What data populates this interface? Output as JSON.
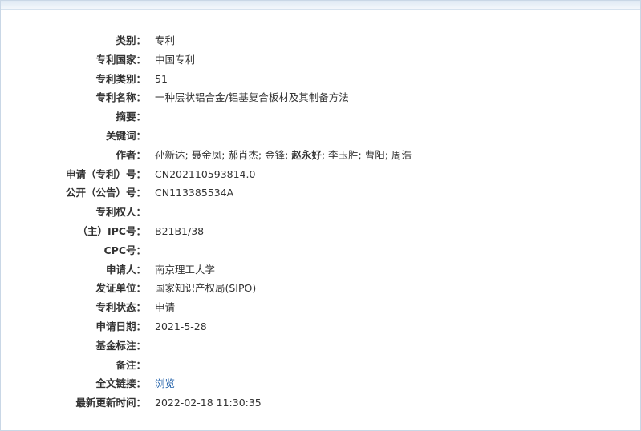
{
  "record": {
    "category": {
      "label": "类别：",
      "value": "专利"
    },
    "country": {
      "label": "专利国家：",
      "value": "中国专利"
    },
    "patent_type": {
      "label": "专利类别：",
      "value": "51"
    },
    "title": {
      "label": "专利名称：",
      "value": "一种层状铝合金/铝基复合板材及其制备方法"
    },
    "abstract": {
      "label": "摘要：",
      "value": ""
    },
    "keywords": {
      "label": "关键词：",
      "value": ""
    },
    "authors": {
      "label": "作者：",
      "values": [
        "孙新达",
        "聂金凤",
        "郝肖杰",
        "金锋",
        "赵永好",
        "李玉胜",
        "曹阳",
        "周浩"
      ],
      "separator": "; "
    },
    "application_no": {
      "label": "申请（专利）号：",
      "value": "CN202110593814.0"
    },
    "publication_no": {
      "label": "公开（公告）号：",
      "value": "CN113385534A"
    },
    "patentee": {
      "label": "专利权人：",
      "value": ""
    },
    "ipc": {
      "label": "（主）IPC号：",
      "value": "B21B1/38"
    },
    "cpc": {
      "label": "CPC号：",
      "value": ""
    },
    "applicant": {
      "label": "申请人：",
      "value": "南京理工大学"
    },
    "issuer": {
      "label": "发证单位：",
      "value": "国家知识产权局(SIPO)"
    },
    "status": {
      "label": "专利状态：",
      "value": "申请"
    },
    "application_date": {
      "label": "申请日期：",
      "value": "2021-5-28"
    },
    "fund": {
      "label": "基金标注：",
      "value": ""
    },
    "note": {
      "label": "备注：",
      "value": ""
    },
    "fulltext": {
      "label": "全文链接：",
      "link_text": "浏览"
    },
    "updated": {
      "label": "最新更新时间：",
      "value": "2022-02-18 11:30:35"
    }
  },
  "colors": {
    "text": "#333333",
    "link": "#1f5fa8",
    "border": "#c9d7e6",
    "band": "#dfe9f4"
  }
}
